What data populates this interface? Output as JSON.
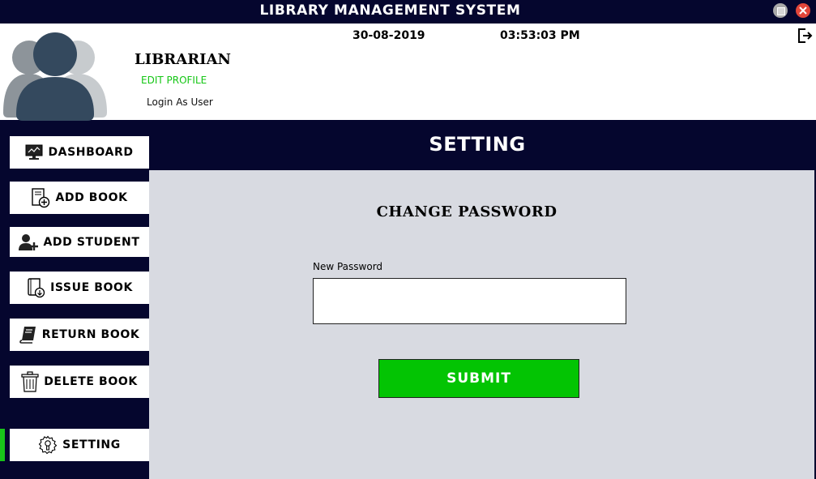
{
  "window": {
    "title": "LIBRARY MANAGEMENT SYSTEM",
    "maximize_icon": "maximize-icon",
    "close_icon": "close-icon"
  },
  "header": {
    "role": "LIBRARIAN",
    "edit_profile": "EDIT PROFILE",
    "login_as_user": "Login As User",
    "date": "30-08-2019",
    "time": "03:53:03 PM",
    "logout_icon": "logout-icon",
    "avatar_icon": "users-avatar-icon"
  },
  "sidebar": {
    "items": [
      {
        "label": "DASHBOARD",
        "icon": "monitor-icon"
      },
      {
        "label": "ADD BOOK",
        "icon": "add-book-icon"
      },
      {
        "label": "ADD STUDENT",
        "icon": "add-user-icon"
      },
      {
        "label": "ISSUE BOOK",
        "icon": "issue-book-icon"
      },
      {
        "label": "RETURN BOOK",
        "icon": "book-icon"
      },
      {
        "label": "DELETE BOOK",
        "icon": "trash-icon"
      },
      {
        "label": "SETTING",
        "icon": "settings-icon",
        "active": true
      }
    ]
  },
  "main": {
    "heading": "SETTING",
    "section_title": "CHANGE PASSWORD",
    "new_password_label": "New Password",
    "new_password_value": "",
    "submit_label": "SUBMIT"
  },
  "colors": {
    "navy": "#05062e",
    "accent_green": "#03c403",
    "content_bg": "#d8dae1"
  }
}
